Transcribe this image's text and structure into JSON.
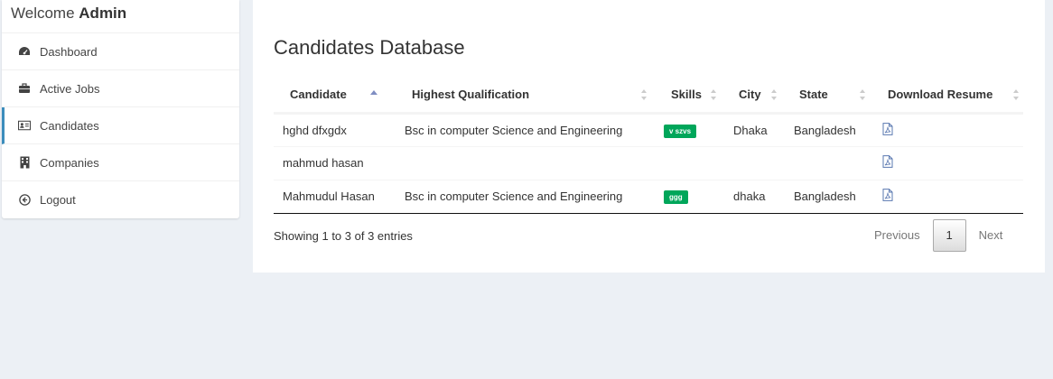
{
  "sidebar": {
    "welcome_prefix": "Welcome",
    "welcome_user": "Admin",
    "items": [
      {
        "label": "Dashboard",
        "icon": "dashboard-icon"
      },
      {
        "label": "Active Jobs",
        "icon": "briefcase-icon"
      },
      {
        "label": "Candidates",
        "icon": "id-card-icon",
        "active": true
      },
      {
        "label": "Companies",
        "icon": "building-icon"
      },
      {
        "label": "Logout",
        "icon": "logout-icon"
      }
    ],
    "active_color": "#3c8dbc"
  },
  "main": {
    "title": "Candidates Database",
    "columns": [
      "Candidate",
      "Highest Qualification",
      "Skills",
      "City",
      "State",
      "Download Resume"
    ],
    "rows": [
      {
        "candidate": "hghd dfxgdx",
        "qualification": "Bsc in computer Science and Engineering",
        "skills": "v szvs",
        "city": "Dhaka",
        "state": "Bangladesh",
        "resume": "pdf-file-icon"
      },
      {
        "candidate": "mahmud hasan",
        "qualification": "",
        "skills": "",
        "city": "",
        "state": "",
        "resume": "pdf-file-icon"
      },
      {
        "candidate": "Mahmudul Hasan",
        "qualification": "Bsc in computer Science and Engineering",
        "skills": "ggg",
        "city": "dhaka",
        "state": "Bangladesh",
        "resume": "pdf-file-icon"
      }
    ],
    "info": "Showing 1 to 3 of 3 entries",
    "pagination": {
      "previous": "Previous",
      "current": "1",
      "next": "Next"
    },
    "badge_color": "#00a65a"
  }
}
